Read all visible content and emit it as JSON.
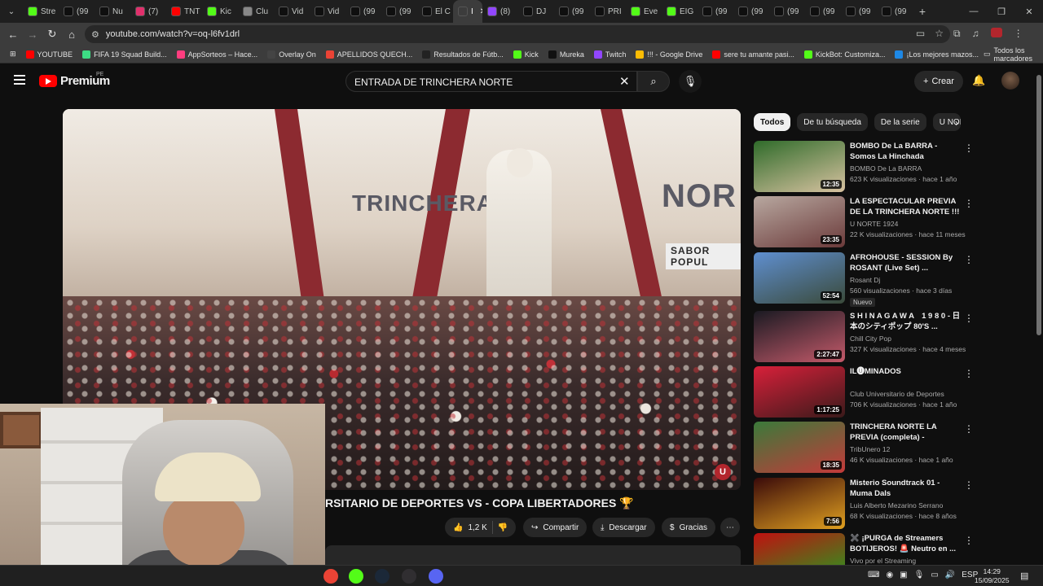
{
  "browser": {
    "tabs": [
      {
        "label": "Stre",
        "color": "#53fc18"
      },
      {
        "label": "(99",
        "color": "#0f0f0f"
      },
      {
        "label": "Nu",
        "color": "#0f0f0f"
      },
      {
        "label": "(7)",
        "color": "#e1306c"
      },
      {
        "label": "TNT",
        "color": "#ff0000"
      },
      {
        "label": "Kic",
        "color": "#53fc18"
      },
      {
        "label": "Clu",
        "color": "#888888"
      },
      {
        "label": "Vid",
        "color": "#0f0f0f"
      },
      {
        "label": "Vid",
        "color": "#0f0f0f"
      },
      {
        "label": "(99",
        "color": "#0f0f0f"
      },
      {
        "label": "(99",
        "color": "#0f0f0f"
      },
      {
        "label": "El C",
        "color": "#0f0f0f"
      },
      {
        "label": "I",
        "color": "#3c3c3c"
      },
      {
        "label": "(8)",
        "color": "#9146ff"
      },
      {
        "label": "DJ",
        "color": "#0f0f0f"
      },
      {
        "label": "(99",
        "color": "#0f0f0f"
      },
      {
        "label": "PRI",
        "color": "#0f0f0f"
      },
      {
        "label": "Eve",
        "color": "#53fc18"
      },
      {
        "label": "EIG",
        "color": "#53fc18"
      },
      {
        "label": "(99",
        "color": "#0f0f0f"
      },
      {
        "label": "(99",
        "color": "#0f0f0f"
      },
      {
        "label": "(99",
        "color": "#0f0f0f"
      },
      {
        "label": "(99",
        "color": "#0f0f0f"
      },
      {
        "label": "(99",
        "color": "#0f0f0f"
      },
      {
        "label": "(99",
        "color": "#0f0f0f"
      }
    ],
    "active_tab_index": 12,
    "url": "youtube.com/watch?v=oq-l6fv1drl",
    "bookmarks": [
      {
        "label": "YOUTUBE",
        "color": "#ff0000"
      },
      {
        "label": "FIFA 19 Squad Build...",
        "color": "#3ddc84"
      },
      {
        "label": "AppSorteos – Hace...",
        "color": "#ff3d7f"
      },
      {
        "label": "Overlay On",
        "color": "#444444"
      },
      {
        "label": "APELLIDOS QUECH...",
        "color": "#ea4335"
      },
      {
        "label": "Resultados de Fútb...",
        "color": "#222222"
      },
      {
        "label": "Kick",
        "color": "#53fc18"
      },
      {
        "label": "Mureka",
        "color": "#111111"
      },
      {
        "label": "Twitch",
        "color": "#9146ff"
      },
      {
        "label": "!!! - Google Drive",
        "color": "#fbbc04"
      },
      {
        "label": "sere tu amante pasi...",
        "color": "#ff0000"
      },
      {
        "label": "KickBot: Customiza...",
        "color": "#53fc18"
      },
      {
        "label": "¡Los mejores mazos...",
        "color": "#1e88e5"
      }
    ],
    "all_bookmarks_label": "Todos los marcadores"
  },
  "youtube": {
    "logo_text": "Premium",
    "region": "PE",
    "search_query": "ENTRADA DE TRINCHERA NORTE",
    "create_label": "Crear",
    "video": {
      "title": "RSITARIO DE DEPORTES VS - COPA LIBERTADORES 🏆",
      "likes": "1,2 K",
      "share_label": "Compartir",
      "download_label": "Descargar",
      "thanks_label": "Gracias",
      "sign_left": "TRINCHERA",
      "sign_right": "NOR",
      "sign_shop": "SABOR POPUL"
    },
    "chips": [
      "Todos",
      "De tu búsqueda",
      "De la serie",
      "U NOR"
    ],
    "recommendations": [
      {
        "title": "BOMBO De La BARRA - Somos La Hinchada (ESTRENO) | Sho...",
        "channel": "BOMBO De La BARRA",
        "meta": "623 K visualizaciones · hace 1 año",
        "duration": "12:35",
        "badge": "",
        "thumb_a": "#2f6b2a",
        "thumb_b": "#d7c2a0"
      },
      {
        "title": "LA ESPECTACULAR PREVIA DE LA TRINCHERA NORTE !!! ...",
        "channel": "U NORTE 1924",
        "meta": "22 K visualizaciones · hace 11 meses",
        "duration": "23:35",
        "badge": "",
        "thumb_a": "#b8a8a0",
        "thumb_b": "#6b3a3a"
      },
      {
        "title": "AFROHOUSE - SESSION By ROSANT (Live Set) ...",
        "channel": "Rosant Dj",
        "meta": "560 visualizaciones · hace 3 días",
        "duration": "52:54",
        "badge": "Nuevo",
        "thumb_a": "#5f8fd0",
        "thumb_b": "#3a4a3a"
      },
      {
        "title": "S H I N A G A W A　1 9 8 0 - 日本のシティポップ 80'S ...",
        "channel": "Chill City Pop",
        "meta": "327 K visualizaciones · hace 4 meses",
        "duration": "2:27:47",
        "badge": "",
        "thumb_a": "#1a1a22",
        "thumb_b": "#c45a6a"
      },
      {
        "title": "IL🅤MINADOS",
        "channel": "Club Universitario de Deportes",
        "meta": "706 K visualizaciones · hace 1 año",
        "duration": "1:17:25",
        "badge": "",
        "thumb_a": "#d8203a",
        "thumb_b": "#3a1a1a"
      },
      {
        "title": "TRINCHERA NORTE LA PREVIA (completa) - UNIVERSITARIO ...",
        "channel": "TribUnero 12",
        "meta": "46 K visualizaciones · hace 1 año",
        "duration": "18:35",
        "badge": "",
        "thumb_a": "#3a7a3a",
        "thumb_b": "#c43a3a"
      },
      {
        "title": "Misterio Soundtrack 01 - Muma Dals",
        "channel": "Luis Alberto Mezarino Serrano",
        "meta": "68 K visualizaciones · hace 8 años",
        "duration": "7:56",
        "badge": "",
        "thumb_a": "#3a0a0a",
        "thumb_b": "#e0a020"
      },
      {
        "title": "✖️ ¡PURGA de Streamers BOTIJEROS! 🚨 Neutro en ...",
        "channel": "Vivo por el Streaming",
        "meta": "",
        "duration": "",
        "badge": "",
        "thumb_a": "#c01010",
        "thumb_b": "#20a020"
      }
    ]
  },
  "taskbar": {
    "apps": [
      {
        "name": "chrome-app",
        "color": "#ea4335"
      },
      {
        "name": "kick-app",
        "color": "#53fc18"
      },
      {
        "name": "steam-app",
        "color": "#1b2838"
      },
      {
        "name": "obs-app",
        "color": "#302e31"
      },
      {
        "name": "discord-app",
        "color": "#5865f2"
      }
    ],
    "lang": "ESP",
    "time": "14:29",
    "date": "15/09/2025"
  }
}
